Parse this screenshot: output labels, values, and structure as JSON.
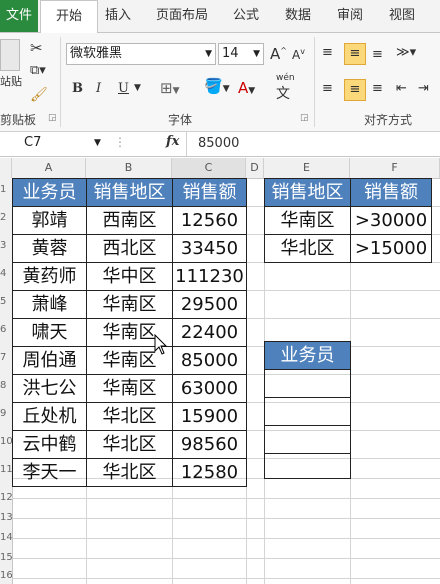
{
  "ribbon_tabs": [
    "文件",
    "开始",
    "插入",
    "页面布局",
    "公式",
    "数据",
    "审阅",
    "视图"
  ],
  "ribbon": {
    "font_name": "微软雅黑",
    "font_size": "14",
    "paste_label": "站贴",
    "clipboard_label": "剪贴板",
    "font_group_label": "字体",
    "align_group_label": "对齐方式",
    "bold": "B",
    "italic": "I",
    "underline": "U",
    "font_color_letter": "A",
    "wen_label": "wén",
    "wen_char": "文"
  },
  "formula_bar": {
    "name_box": "C7",
    "fx": "fx",
    "value": "85000"
  },
  "columns": [
    "A",
    "B",
    "C",
    "D",
    "E",
    "F"
  ],
  "rows": [
    "1",
    "2",
    "3",
    "4",
    "5",
    "6",
    "7",
    "8",
    "9",
    "10",
    "11",
    "12",
    "13",
    "14",
    "15",
    "16"
  ],
  "table_header": {
    "a": "业务员",
    "b": "销售地区",
    "c": "销售额"
  },
  "table_rows": [
    {
      "a": "郭靖",
      "b": "西南区",
      "c": "12560"
    },
    {
      "a": "黄蓉",
      "b": "西北区",
      "c": "33450"
    },
    {
      "a": "黄药师",
      "b": "华中区",
      "c": "111230"
    },
    {
      "a": "萧峰",
      "b": "华南区",
      "c": "29500"
    },
    {
      "a": "啸天",
      "b": "华南区",
      "c": "22400"
    },
    {
      "a": "周伯通",
      "b": "华南区",
      "c": "85000"
    },
    {
      "a": "洪七公",
      "b": "华南区",
      "c": "63000"
    },
    {
      "a": "丘处机",
      "b": "华北区",
      "c": "15900"
    },
    {
      "a": "云中鹤",
      "b": "华北区",
      "c": "98560"
    },
    {
      "a": "李天一",
      "b": "华北区",
      "c": "12580"
    }
  ],
  "criteria": {
    "header": {
      "e": "销售地区",
      "f": "销售额"
    },
    "rows": [
      {
        "e": "华南区",
        "f": ">30000"
      },
      {
        "e": "华北区",
        "f": ">15000"
      }
    ]
  },
  "output_header": "业务员",
  "colors": {
    "header_fill": "#4f81bd",
    "file_tab": "#2a8a3e",
    "highlight": "#fbd97b"
  }
}
